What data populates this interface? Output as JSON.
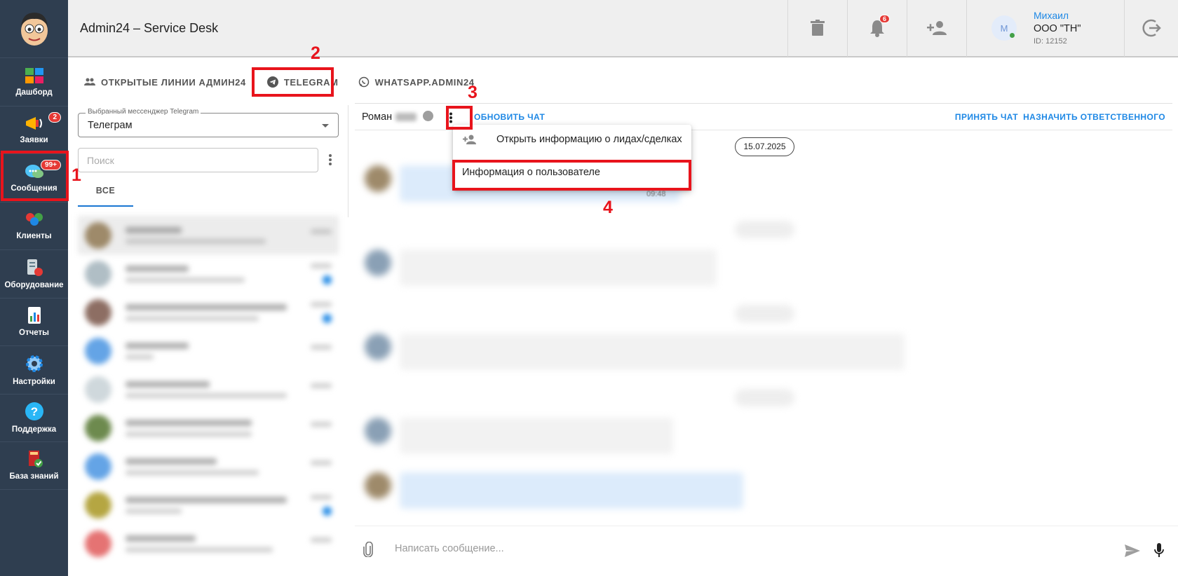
{
  "app": {
    "title": "Admin24 – Service Desk"
  },
  "sidebar": {
    "items": [
      {
        "label": "Дашборд",
        "icon": "dashboard-icon"
      },
      {
        "label": "Заявки",
        "icon": "megaphone-icon",
        "badge": "2"
      },
      {
        "label": "Сообщения",
        "icon": "chat-bubbles-icon",
        "badge": "99+"
      },
      {
        "label": "Клиенты",
        "icon": "clients-icon"
      },
      {
        "label": "Оборудование",
        "icon": "equipment-icon"
      },
      {
        "label": "Отчеты",
        "icon": "reports-icon"
      },
      {
        "label": "Настройки",
        "icon": "gear-icon"
      },
      {
        "label": "Поддержка",
        "icon": "help-icon"
      },
      {
        "label": "База знаний",
        "icon": "book-icon"
      }
    ]
  },
  "topbar": {
    "notifications_count": "6",
    "user": {
      "avatar_letter": "М",
      "name": "Михаил",
      "org": "ООО \"ТН\"",
      "id": "ID: 12152"
    }
  },
  "tabs": [
    {
      "label": "ОТКРЫТЫЕ ЛИНИИ АДМИН24"
    },
    {
      "label": "TELEGRAM"
    },
    {
      "label": "WHATSAPP.ADMIN24"
    }
  ],
  "left_panel": {
    "messenger_label": "Выбранный мессенджер Telegram",
    "messenger_value": "Телеграм",
    "search_placeholder": "Поиск",
    "filter_tab": "ВСЕ"
  },
  "chat_header": {
    "name": "Роман",
    "refresh": "ОБНОВИТЬ ЧАТ",
    "accept": "ПРИНЯТЬ ЧАТ",
    "assign": "НАЗНАЧИТЬ ОТВЕТСТВЕННОГО"
  },
  "chat": {
    "date": "15.07.2025",
    "msg_time": "09:48"
  },
  "menu": {
    "item1": "Открыть информацию о лидах/сделках",
    "item2": "Информация о пользователе"
  },
  "compose": {
    "placeholder": "Написать сообщение..."
  },
  "annotations": {
    "n1": "1",
    "n2": "2",
    "n3": "3",
    "n4": "4"
  },
  "colors": {
    "sidebar": "#2f3e50",
    "accent": "#1e88e5",
    "highlight": "#e8141c"
  }
}
